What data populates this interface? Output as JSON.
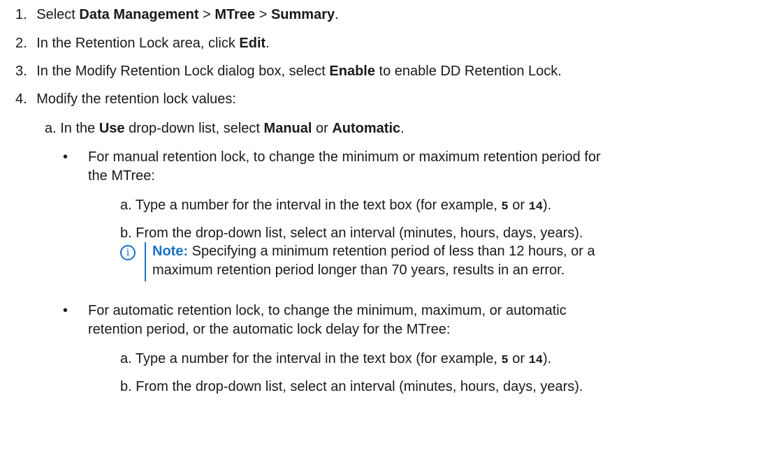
{
  "steps": [
    {
      "num": "1.",
      "pre": "Select ",
      "b1": "Data Management",
      "mid1": " > ",
      "b2": "MTree",
      "mid2": " > ",
      "b3": "Summary",
      "post": "."
    },
    {
      "num": "2.",
      "pre": "In the Retention Lock area, click ",
      "b1": "Edit",
      "post": "."
    },
    {
      "num": "3.",
      "pre": "In the Modify Retention Lock dialog box, select ",
      "b1": "Enable",
      "post": " to enable DD Retention Lock."
    },
    {
      "num": "4.",
      "text": "Modify the retention lock values:"
    }
  ],
  "sub_a": {
    "pre": "a. In the ",
    "b1": "Use",
    "mid1": " drop-down list, select ",
    "b2": "Manual",
    "mid2": " or ",
    "b3": "Automatic",
    "post": "."
  },
  "bullet_manual": {
    "symbol": "•",
    "line1": "For manual retention lock, to change the minimum or maximum retention period for",
    "line2": "the MTree:",
    "step_a": {
      "pre": "a. Type a number for the interval in the text box (for example, ",
      "code1": "5",
      "mid": " or ",
      "code2": "14",
      "post": ")."
    },
    "step_b": "b. From the drop-down list, select an interval (minutes, hours, days, years).",
    "note": {
      "icon": "i",
      "label": "Note:",
      "line1": " Specifying a minimum retention period of less than 12 hours, or a",
      "line2": "maximum retention period longer than 70 years, results in an error."
    }
  },
  "bullet_auto": {
    "symbol": "•",
    "line1": "For automatic retention lock, to change the minimum, maximum, or automatic",
    "line2": "retention period, or the automatic lock delay for the MTree:",
    "step_a": {
      "pre": "a. Type a number for the interval in the text box (for example, ",
      "code1": "5",
      "mid": " or ",
      "code2": "14",
      "post": ")."
    },
    "step_b": "b. From the drop-down list, select an interval (minutes, hours, days, years)."
  }
}
